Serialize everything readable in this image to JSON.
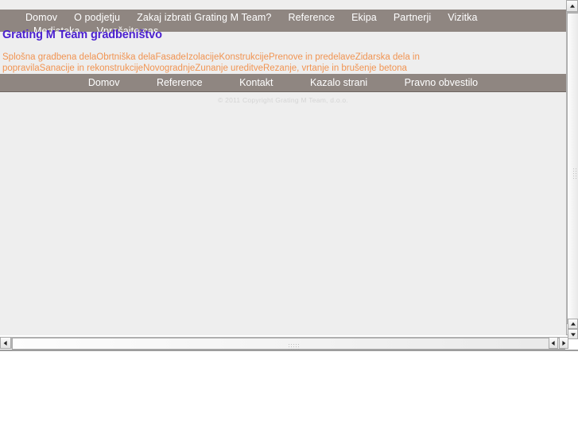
{
  "page": {
    "heading": "Grating M Team gradbeništvo",
    "heading_color": "#4a1fd0",
    "background_color": "#eeeeee",
    "nav_bar_color": "#8f8681",
    "services_color": "#f19452"
  },
  "top_nav": {
    "row1": [
      {
        "label": "Domov"
      },
      {
        "label": "O podjetju"
      },
      {
        "label": "Zakaj izbrati Grating M Team?"
      },
      {
        "label": "Reference"
      },
      {
        "label": "Ekipa"
      },
      {
        "label": "Partnerji"
      },
      {
        "label": "Vizitka"
      }
    ],
    "row2": [
      {
        "label": "Mediateka"
      },
      {
        "label": "Vprašajte nas"
      }
    ]
  },
  "services": {
    "items": [
      "Splošna gradbena dela",
      "Obrtniška dela",
      "Fasade",
      "Izolacije",
      "Konstrukcije",
      "Prenove in predelave",
      "Zidarska dela in popravila",
      "Sanacije in rekonstrukcije",
      "Novogradnje",
      "Zunanje ureditve",
      "Rezanje, vrtanje in brušenje betona"
    ]
  },
  "footer_nav": {
    "items": [
      {
        "label": "Domov"
      },
      {
        "label": "Reference"
      },
      {
        "label": "Kontakt"
      },
      {
        "label": "Kazalo strani"
      },
      {
        "label": "Pravno obvestilo"
      }
    ]
  },
  "copyright": {
    "text": "© 2011 Copyright Grating M Team, d.o.o."
  },
  "scrollbars": {
    "vertical": {
      "up_icon": "scroll-up-arrow",
      "down_icon": "scroll-down-arrow",
      "thumb_grip": "grip-dots"
    },
    "horizontal": {
      "left_icon": "scroll-left-arrow",
      "right_icon": "scroll-right-arrow",
      "thumb_grip": "grip-dots"
    },
    "corner": {
      "left_icon": "nav-back-arrow",
      "right_icon": "nav-forward-arrow"
    },
    "outer_vertical": {
      "up_icon": "scroll-up-arrow",
      "down_icon": "scroll-down-arrow"
    }
  }
}
